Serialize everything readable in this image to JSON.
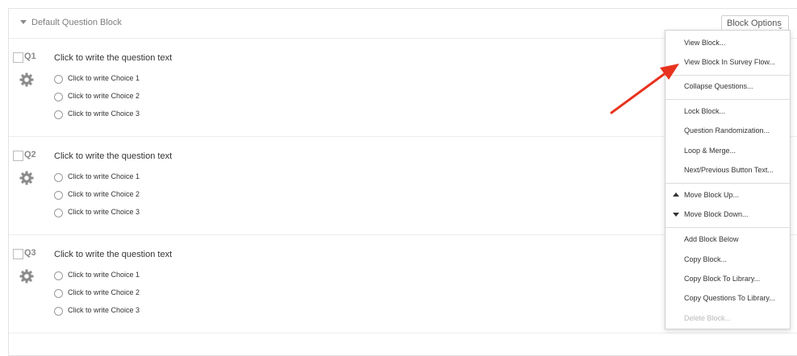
{
  "block": {
    "title": "Default Question Block",
    "options_label": "Block Options"
  },
  "questions": [
    {
      "number": "Q1",
      "text": "Click to write the question text",
      "choices": [
        "Click to write Choice 1",
        "Click to write Choice 2",
        "Click to write Choice 3"
      ]
    },
    {
      "number": "Q2",
      "text": "Click to write the question text",
      "choices": [
        "Click to write Choice 1",
        "Click to write Choice 2",
        "Click to write Choice 3"
      ]
    },
    {
      "number": "Q3",
      "text": "Click to write the question text",
      "choices": [
        "Click to write Choice 1",
        "Click to write Choice 2",
        "Click to write Choice 3"
      ]
    }
  ],
  "menu": {
    "items": [
      "View Block...",
      "View Block In Survey Flow...",
      "Collapse Questions...",
      "Lock Block...",
      "Question Randomization...",
      "Loop & Merge...",
      "Next/Previous Button Text...",
      "Move Block Up...",
      "Move Block Down...",
      "Add Block Below",
      "Copy Block...",
      "Copy Block To Library...",
      "Copy Questions To Library...",
      "Delete Block..."
    ]
  },
  "colors": {
    "annotation_arrow": "#e8321e",
    "gear": "#8c8c8c"
  },
  "icons": {
    "question_settings": "gear-icon",
    "annotation": "red-arrow-icon"
  }
}
